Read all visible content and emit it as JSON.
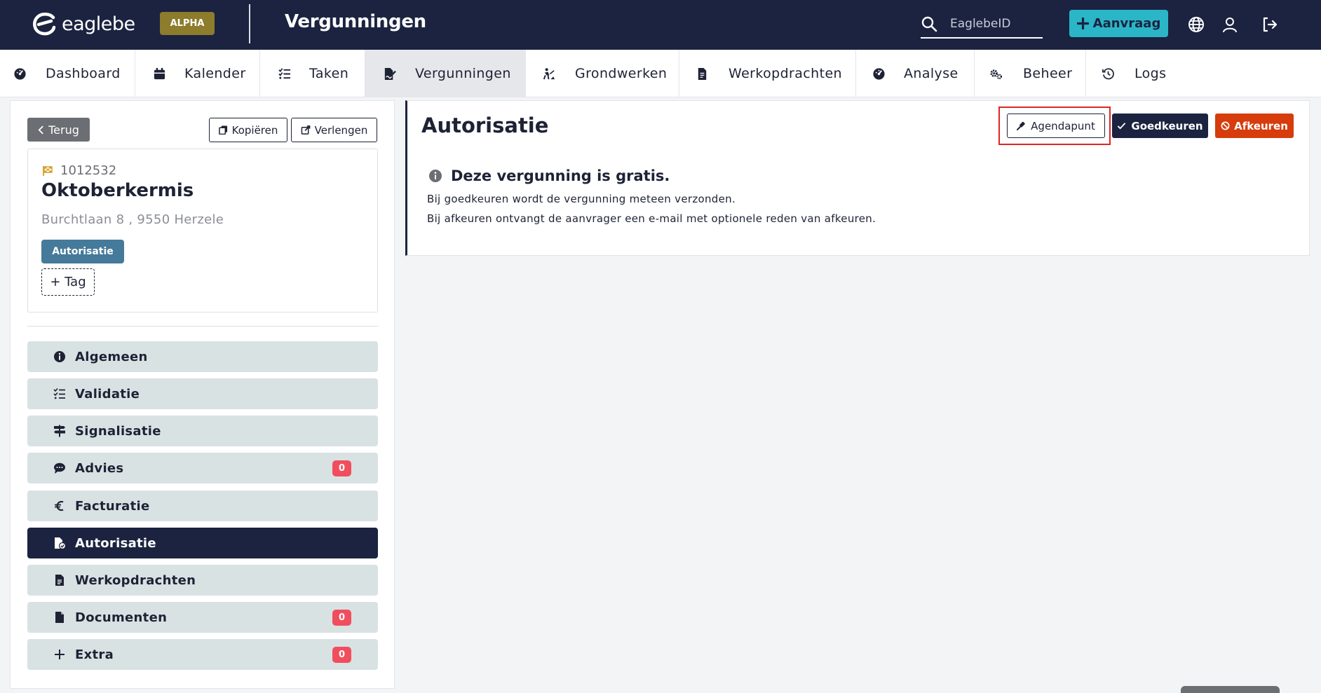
{
  "header": {
    "logo_text": "eaglebe",
    "badge": "ALPHA",
    "page_title": "Vergunningen",
    "search_placeholder": "EaglebeID",
    "new_request_label": "Aanvraag",
    "icons": [
      "globe-icon",
      "user-icon",
      "logout-icon"
    ]
  },
  "nav": {
    "tabs": [
      {
        "label": "Dashboard",
        "icon": "gauge-icon"
      },
      {
        "label": "Kalender",
        "icon": "calendar-icon"
      },
      {
        "label": "Taken",
        "icon": "task-list-icon"
      },
      {
        "label": "Vergunningen",
        "icon": "file-signature-icon",
        "active": true
      },
      {
        "label": "Grondwerken",
        "icon": "digging-icon"
      },
      {
        "label": "Werkopdrachten",
        "icon": "document-icon"
      },
      {
        "label": "Analyse",
        "icon": "gauge-icon"
      },
      {
        "label": "Beheer",
        "icon": "gears-icon"
      },
      {
        "label": "Logs",
        "icon": "history-icon"
      }
    ]
  },
  "sidebar": {
    "back_label": "Terug",
    "copy_label": "Kopiëren",
    "extend_label": "Verlengen",
    "permit_id": "1012532",
    "permit_name": "Oktoberkermis",
    "address": "Burchtlaan 8 , 9550 Herzele",
    "status_tag": "Autorisatie",
    "add_tag_label": "+ Tag",
    "menu": [
      {
        "label": "Algemeen",
        "icon": "info-circle-icon"
      },
      {
        "label": "Validatie",
        "icon": "checklist-icon"
      },
      {
        "label": "Signalisatie",
        "icon": "signpost-icon"
      },
      {
        "label": "Advies",
        "icon": "comment-icon",
        "count": "0"
      },
      {
        "label": "Facturatie",
        "icon": "euro-icon"
      },
      {
        "label": "Autorisatie",
        "icon": "file-check-icon",
        "active": true
      },
      {
        "label": "Werkopdrachten",
        "icon": "document-icon"
      },
      {
        "label": "Documenten",
        "icon": "file-icon",
        "count": "0"
      },
      {
        "label": "Extra",
        "icon": "plus-icon",
        "count": "0"
      }
    ]
  },
  "main": {
    "title": "Autorisatie",
    "agenda_label": "Agendapunt",
    "approve_label": "Goedkeuren",
    "reject_label": "Afkeuren",
    "notice_title": "Deze vergunning is gratis.",
    "notice_line1": "Bij goedkeuren wordt de vergunning meteen verzonden.",
    "notice_line2": "Bij afkeuren ontvangt de aanvrager een e-mail met optionele reden van afkeuren."
  },
  "colors": {
    "header_bg": "#1b2340",
    "accent_teal": "#2bb6c8",
    "alpha_badge": "#8c7c2b",
    "tag_blue": "#457a9a",
    "reject_red": "#d63c0c",
    "count_badge": "#f04e5e",
    "menu_bg": "#d9e2e3"
  }
}
